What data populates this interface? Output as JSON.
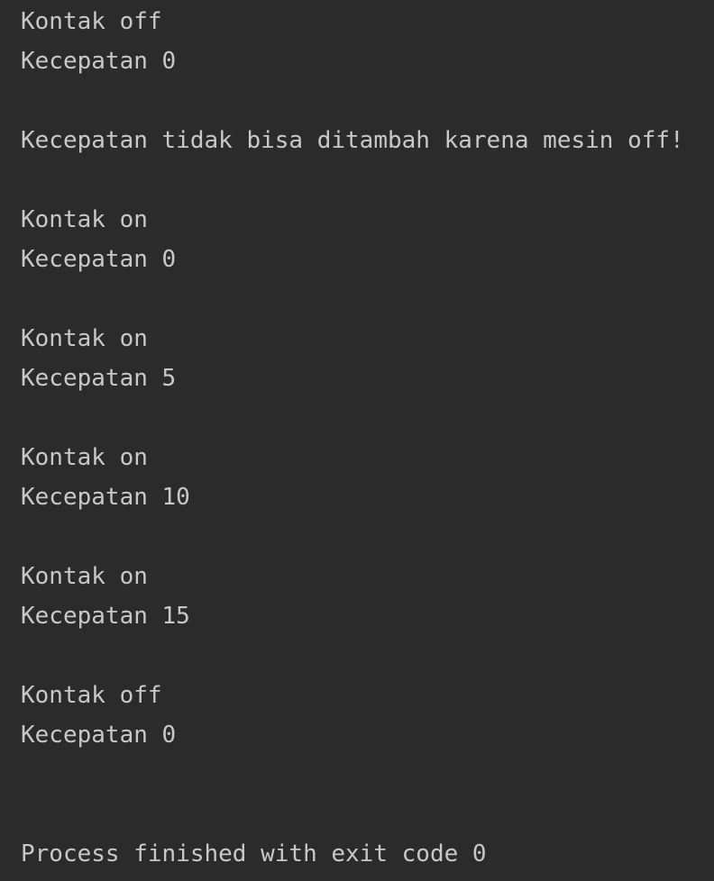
{
  "console": {
    "lines": [
      "Kontak off",
      "Kecepatan 0",
      "",
      "Kecepatan tidak bisa ditambah karena mesin off!",
      "",
      "Kontak on",
      "Kecepatan 0",
      "",
      "Kontak on",
      "Kecepatan 5",
      "",
      "Kontak on",
      "Kecepatan 10",
      "",
      "Kontak on",
      "Kecepatan 15",
      "",
      "Kontak off",
      "Kecepatan 0",
      "",
      "",
      "Process finished with exit code 0"
    ]
  },
  "colors": {
    "background": "#2b2b2b",
    "text": "#c8c8c8"
  }
}
